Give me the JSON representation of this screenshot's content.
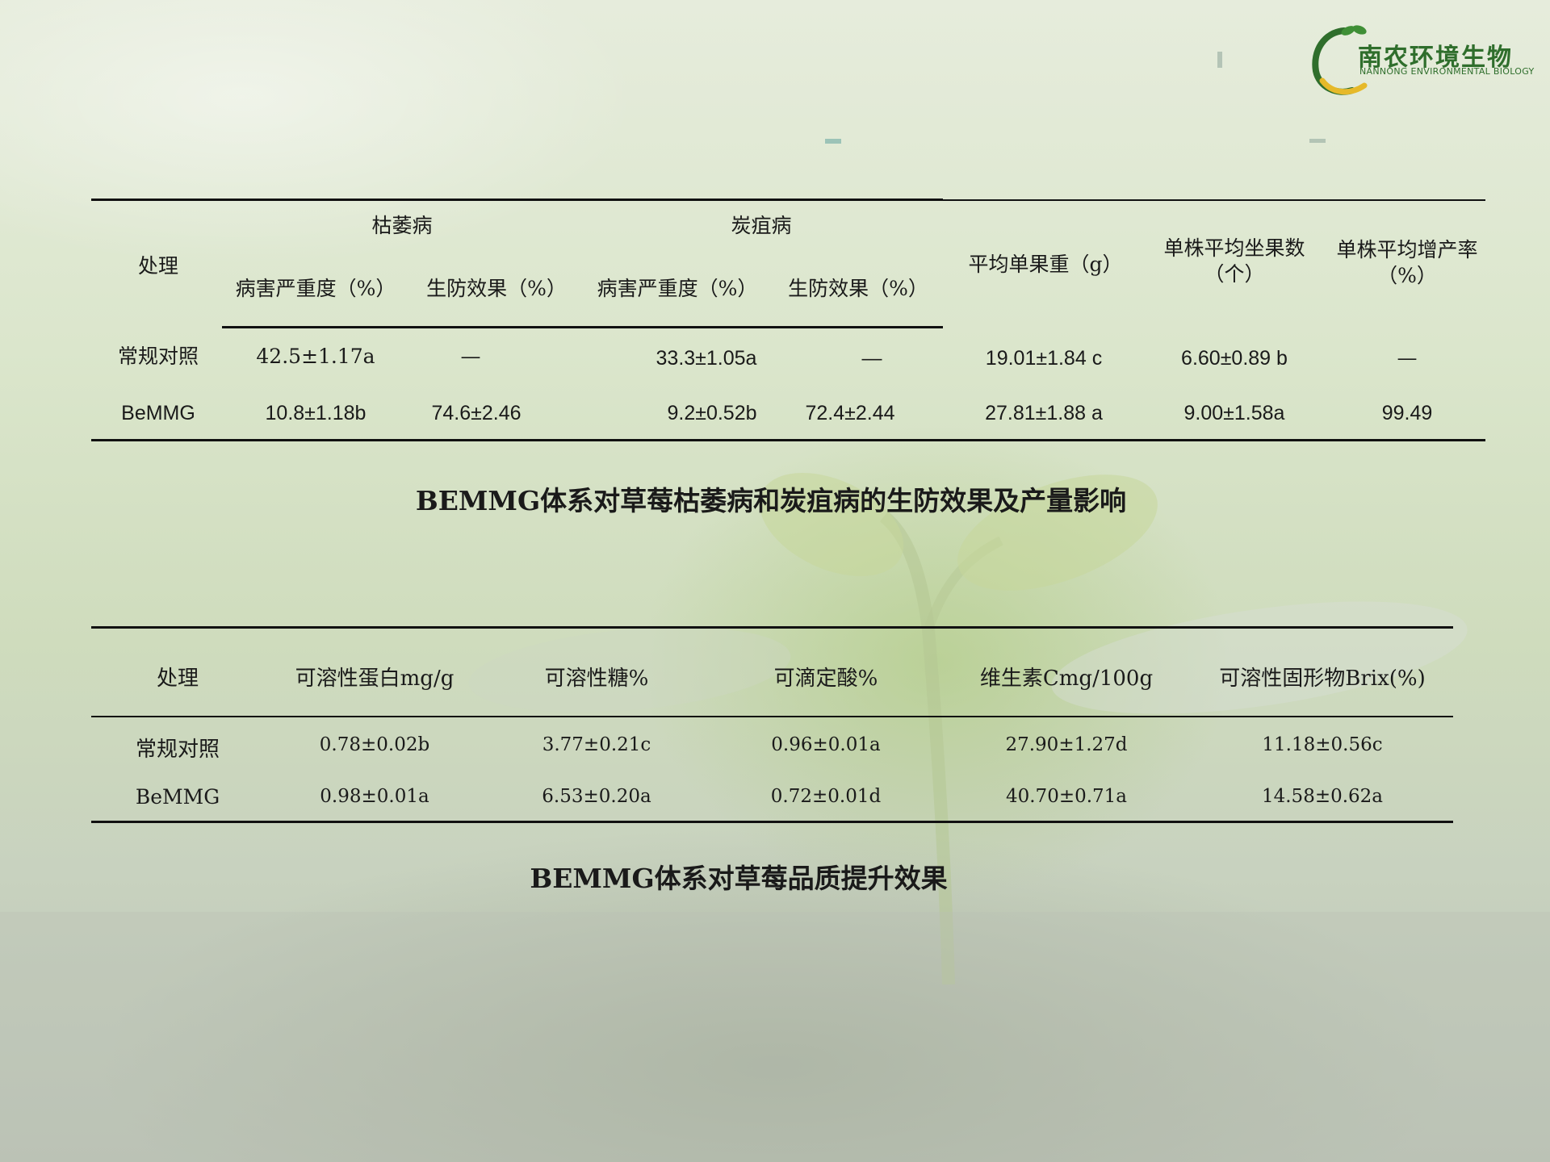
{
  "logo": {
    "name_cn": "南农环境生物",
    "name_en": "NANNONG ENVIRONMENTAL BIOLOGY",
    "colors": {
      "green": "#2f6e2c",
      "yellow": "#e6b92a"
    }
  },
  "table1": {
    "header": {
      "treatment": "处理",
      "fusarium": "枯萎病",
      "anthracnose": "炭疽病",
      "severity": "病害严重度（%）",
      "efficacy": "生防效果（%）",
      "fruit_weight": "平均单果重（g）",
      "fruit_count": "单株平均坐果数（个）",
      "yield_increase": "单株平均增产率（%）"
    },
    "rows": [
      {
        "treatment": "常规对照",
        "fus_severity": "42.5±1.17a",
        "fus_efficacy": "—",
        "anth_severity": "33.3±1.05a",
        "anth_efficacy": "—",
        "fruit_weight": "19.01±1.84 c",
        "fruit_count": "6.60±0.89 b",
        "yield_increase": "—"
      },
      {
        "treatment": "BeMMG",
        "fus_severity": "10.8±1.18b",
        "fus_efficacy": "74.6±2.46",
        "anth_severity": "9.2±0.52b",
        "anth_efficacy": "72.4±2.44",
        "fruit_weight": "27.81±1.88 a",
        "fruit_count": "9.00±1.58a",
        "yield_increase": "99.49"
      }
    ],
    "caption": "BEMMG体系对草莓枯萎病和炭疽病的生防效果及产量影响"
  },
  "table2": {
    "headers": [
      "处理",
      "可溶性蛋白mg/g",
      "可溶性糖%",
      "可滴定酸%",
      "维生素Cmg/100g",
      "可溶性固形物Brix(%)"
    ],
    "rows": [
      [
        "常规对照",
        "0.78±0.02b",
        "3.77±0.21c",
        "0.96±0.01a",
        "27.90±1.27d",
        "11.18±0.56c"
      ],
      [
        "BeMMG",
        "0.98±0.01a",
        "6.53±0.20a",
        "0.72±0.01d",
        "40.70±0.71a",
        "14.58±0.62a"
      ]
    ],
    "caption": "BEMMG体系对草莓品质提升效果"
  }
}
